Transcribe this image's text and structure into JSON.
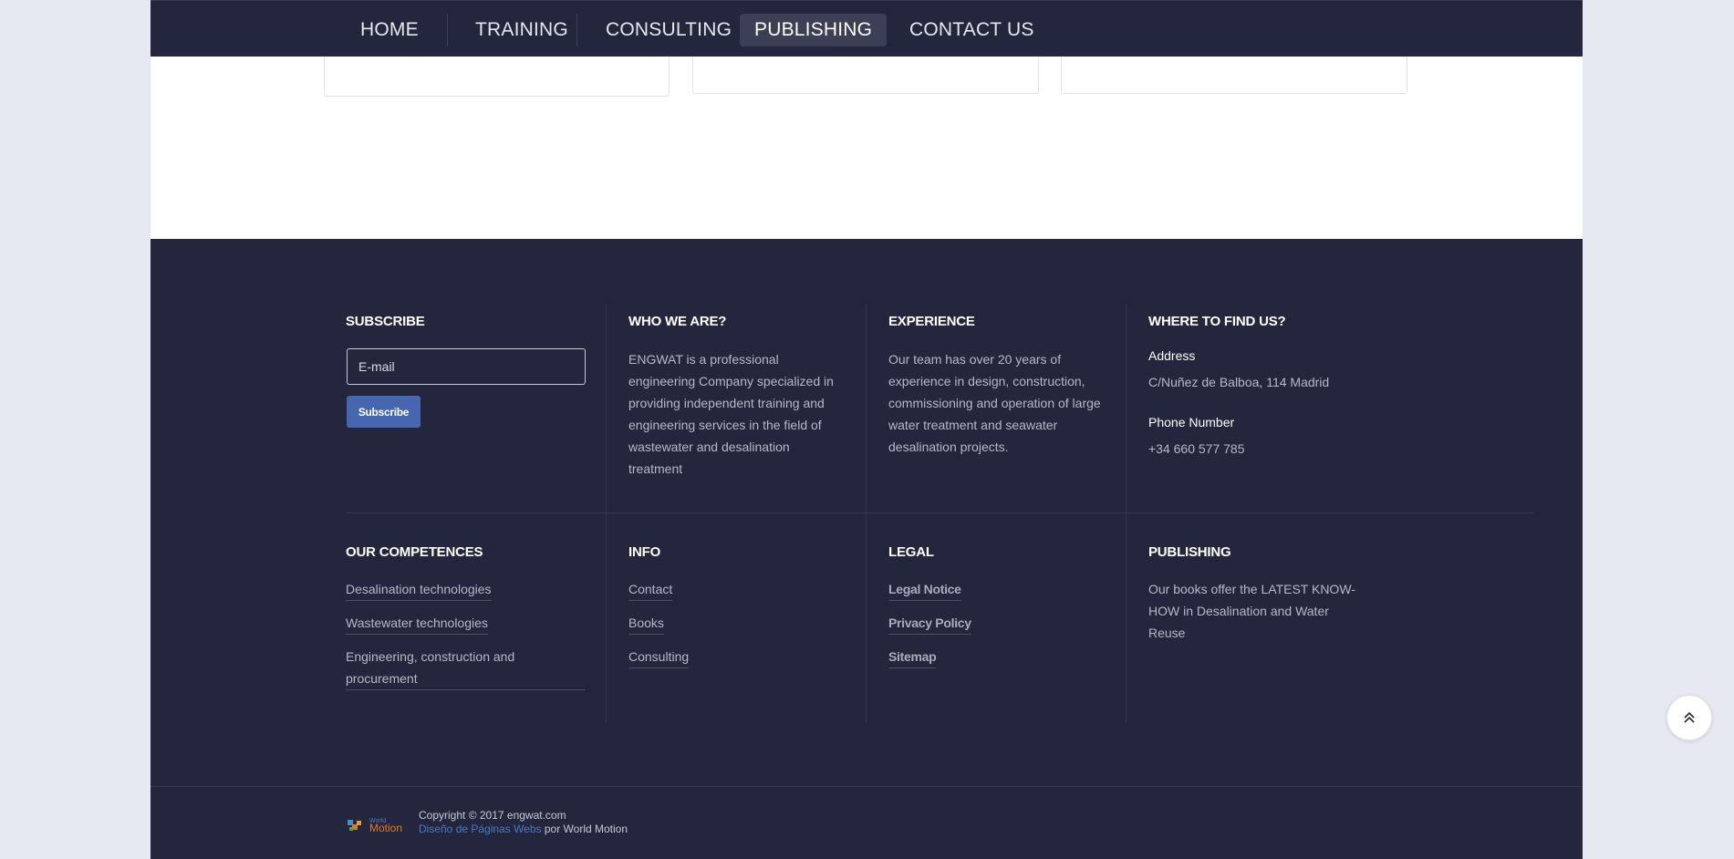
{
  "nav": {
    "items": [
      {
        "label": "HOME"
      },
      {
        "label": "TRAINING"
      },
      {
        "label": "CONSULTING"
      },
      {
        "label": "PUBLISHING"
      },
      {
        "label": "CONTACT US"
      }
    ],
    "active_index": 3
  },
  "footer": {
    "subscribe": {
      "heading": "SUBSCRIBE",
      "placeholder": "E-mail",
      "button": "Subscribe"
    },
    "who": {
      "heading": "WHO WE ARE?",
      "lines": [
        "ENGWAT is a professional",
        "engineering Company specialized in",
        "providing independent training and",
        "engineering services in the field of",
        "wastewater and desalination",
        "treatment"
      ]
    },
    "experience": {
      "heading": "EXPERIENCE",
      "lines": [
        "Our team has over 20 years of",
        "experience in design, construction,",
        "commissioning and operation of large",
        "water treatment and seawater",
        "desalination projects."
      ]
    },
    "where": {
      "heading": "WHERE TO FIND US?",
      "address_label": "Address",
      "address": "C/Nuñez de Balboa, 114 Madrid",
      "phone_label": "Phone Number",
      "phone": "+34 660 577 785"
    },
    "competences": {
      "heading": "OUR COMPETENCES",
      "items": [
        "Desalination technologies",
        "Wastewater technologies",
        "Engineering, construction and procurement"
      ]
    },
    "info": {
      "heading": "INFO",
      "items": [
        "Contact",
        "Books",
        "Consulting"
      ]
    },
    "legal": {
      "heading": "LEGAL",
      "items": [
        "Legal Notice",
        "Privacy Policy",
        "Sitemap"
      ]
    },
    "publishing": {
      "heading": "PUBLISHING",
      "lines": [
        "Our books offer the LATEST KNOW-",
        "HOW in Desalination and Water",
        "Reuse"
      ]
    },
    "bottom": {
      "logo_top": "World",
      "logo_bottom": "Motion",
      "copyright": "Copyright © 2017 engwat.com",
      "design_link": "Diseño de Páginas Webs",
      "by": "por World Motion"
    }
  },
  "colors": {
    "nav_bg": "#24263d",
    "footer_bg": "#24263d",
    "button": "#4667b0",
    "link_blue": "#4f78c4",
    "page_bg": "#e6e9f1"
  },
  "icons": {
    "scroll_top": "double-chevron-up-icon",
    "logo": "world-motion-puzzle-logo"
  }
}
